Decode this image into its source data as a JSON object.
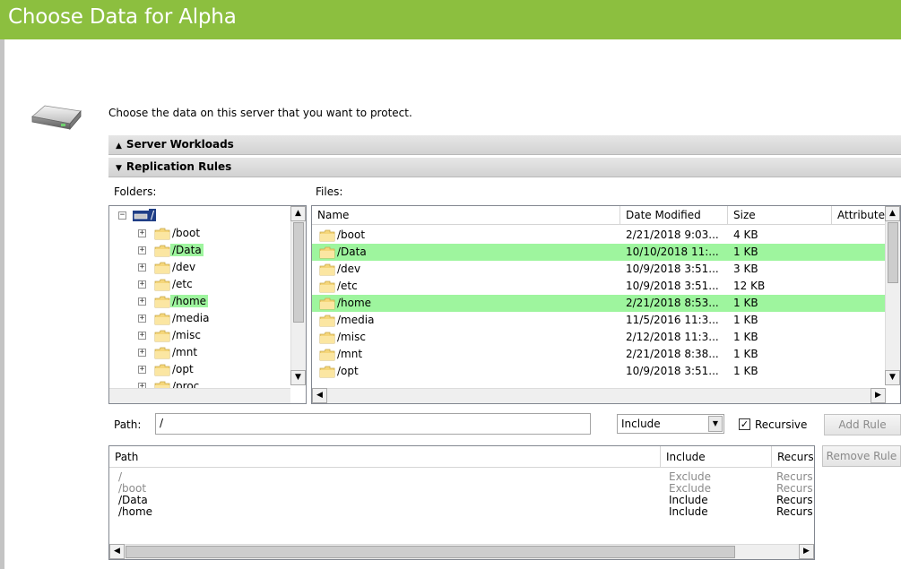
{
  "header": {
    "title": "Choose Data for Alpha"
  },
  "intro": "Choose the data on this server that you want to protect.",
  "sections": {
    "server_workloads": {
      "arrow": "▲",
      "label": "Server Workloads"
    },
    "replication_rules": {
      "arrow": "▼",
      "label": "Replication Rules"
    }
  },
  "folders": {
    "label": "Folders:",
    "root": "/",
    "items": [
      "/boot",
      "/Data",
      "/dev",
      "/etc",
      "/home",
      "/media",
      "/misc",
      "/mnt",
      "/opt",
      "/proc"
    ]
  },
  "files": {
    "label": "Files:",
    "columns": [
      "Name",
      "Date Modified",
      "Size",
      "Attributes"
    ],
    "rows": [
      {
        "name": "/boot",
        "date": "2/21/2018 9:03...",
        "size": "4 KB"
      },
      {
        "name": "/Data",
        "date": "10/10/2018 11:...",
        "size": "1 KB"
      },
      {
        "name": "/dev",
        "date": "10/9/2018 3:51...",
        "size": "3 KB"
      },
      {
        "name": "/etc",
        "date": "10/9/2018 3:51...",
        "size": "12 KB"
      },
      {
        "name": "/home",
        "date": "2/21/2018 8:53...",
        "size": "1 KB"
      },
      {
        "name": "/media",
        "date": "11/5/2016 11:3...",
        "size": "1 KB"
      },
      {
        "name": "/misc",
        "date": "2/12/2018 11:3...",
        "size": "1 KB"
      },
      {
        "name": "/mnt",
        "date": "2/21/2018 8:38...",
        "size": "1 KB"
      },
      {
        "name": "/opt",
        "date": "10/9/2018 3:51...",
        "size": "1 KB"
      }
    ]
  },
  "path": {
    "label": "Path:",
    "value": "/"
  },
  "include_select": {
    "value": "Include"
  },
  "recursive": {
    "label": "Recursive",
    "checked": "✓"
  },
  "buttons": {
    "add_rule": "Add Rule",
    "remove_rule": "Remove Rule"
  },
  "rules": {
    "columns": [
      "Path",
      "Include",
      "Recursive"
    ],
    "rows": [
      {
        "path": "/",
        "include": "Exclude",
        "recursive": "Recursive"
      },
      {
        "path": "/boot",
        "include": "Exclude",
        "recursive": "Recursive"
      },
      {
        "path": "/Data",
        "include": "Include",
        "recursive": "Recursive"
      },
      {
        "path": "/home",
        "include": "Include",
        "recursive": "Recursive"
      }
    ]
  },
  "colors": {
    "accent": "#8cbf3f",
    "highlight": "#9ef59e"
  }
}
